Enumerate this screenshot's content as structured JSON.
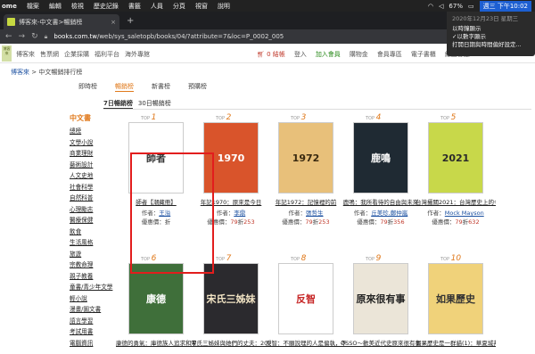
{
  "menubar": {
    "app": "ome",
    "items": [
      "檔案",
      "編輯",
      "檢視",
      "歷史記錄",
      "書籤",
      "人員",
      "分頁",
      "視窗",
      "說明"
    ],
    "battery": "67%",
    "clock": "週三 下午10:02"
  },
  "clock_menu": {
    "date": "2020年12月23日 星期三",
    "option1": "以時鐘顯示",
    "option2": "✓以數字顯示",
    "option3": "打開日期與時間偏好設定..."
  },
  "browser": {
    "tab_title": "博客來-中文書>暢銷榜",
    "tab_close": "×",
    "new_tab": "+",
    "url_host": "books.com.tw",
    "url_path": "/web/sys_saletopb/books/04/?attribute=7&loc=P_0002_005"
  },
  "header": {
    "logo": "博客來",
    "nav": [
      "博客來",
      "售票網",
      "企業採購",
      "福利平台",
      "海外專館"
    ],
    "cart": "0 結帳",
    "login": "登入",
    "member": "加入會員",
    "links": [
      "購物金",
      "會員專區",
      "電子書櫃",
      "線上客服"
    ]
  },
  "breadcrumb": {
    "home": "博客來",
    "sep": ">",
    "current": "中文暢銷排行榜"
  },
  "section_tabs": [
    "即時榜",
    "暢銷榜",
    "新書榜",
    "預購榜"
  ],
  "sub_tabs": [
    "7日暢銷榜",
    "30日暢銷榜"
  ],
  "sidebar": {
    "title": "中文書",
    "items": [
      "總榜",
      "文學小說",
      "商業理財",
      "藝術設計",
      "人文史地",
      "社會科學",
      "自然科普",
      "心理勵志",
      "醫療保健",
      "飲食",
      "生活風格",
      "旅遊",
      "宗教命理",
      "親子教養",
      "童書/青少年文學",
      "輕小說",
      "漫畫/圖文書",
      "語言學習",
      "考試用書",
      "電腦資訊"
    ]
  },
  "books_row1": [
    {
      "rank": "1",
      "title": "師者【潮藏冊】",
      "author": "王溢",
      "discount": "",
      "price": "",
      "cover_text": "師者",
      "bg": "#ffffff",
      "fg": "#333333"
    },
    {
      "rank": "2",
      "title": "年記1970：原來是今日",
      "author": "李鼎",
      "discount": "79",
      "price": "253",
      "cover_text": "1970",
      "bg": "#d9542b",
      "fg": "#ffffff"
    },
    {
      "rank": "3",
      "title": "年記1972：記憶裡的前",
      "author": "張哲生",
      "discount": "79",
      "price": "253",
      "cover_text": "1972",
      "bg": "#e8c07a",
      "fg": "#3a2a10"
    },
    {
      "rank": "4",
      "title": "鹿鳴：我所看待的自由與未來",
      "author": "丘美珍,鄭仲嵐",
      "discount": "79",
      "price": "356",
      "cover_text": "鹿鳴",
      "bg": "#1f2a33",
      "fg": "#ffffff"
    },
    {
      "rank": "5",
      "title": "台灣攝關2021：台灣歷史上的今天",
      "author": "Mock Mayson",
      "discount": "79",
      "price": "632",
      "cover_text": "2021",
      "bg": "#c8d84a",
      "fg": "#2a2a2a"
    }
  ],
  "books_row2": [
    {
      "rank": "6",
      "title": "康德的勇氣：庫德族人追求和平與獨立的故",
      "cover_text": "康德",
      "bg": "#3f6f3a",
      "fg": "#ffffff"
    },
    {
      "rank": "7",
      "title": "宋氏三姊妹與她們的丈夫：20世紀三女性",
      "cover_text": "宋氏三姊妹",
      "bg": "#2b2a2e",
      "fg": "#f2e4c4"
    },
    {
      "rank": "8",
      "title": "反智：不願說理的人是偏執，不會說理的",
      "cover_text": "反智",
      "bg": "#ffffff",
      "fg": "#c72828"
    },
    {
      "rank": "9",
      "title": "OSSO～歡美近代史原來很有事",
      "cover_text": "原來很有事",
      "bg": "#ebe5d8",
      "fg": "#222222"
    },
    {
      "rank": "10",
      "title": "如果歷史是一群貓(1)：華夏城邦【超級漫畫",
      "cover_text": "如果歷史",
      "bg": "#f0d27a",
      "fg": "#333333"
    }
  ],
  "labels": {
    "author": "作者：",
    "price_prefix": "優惠價：",
    "price_mid": "折",
    "top": "TOP"
  }
}
